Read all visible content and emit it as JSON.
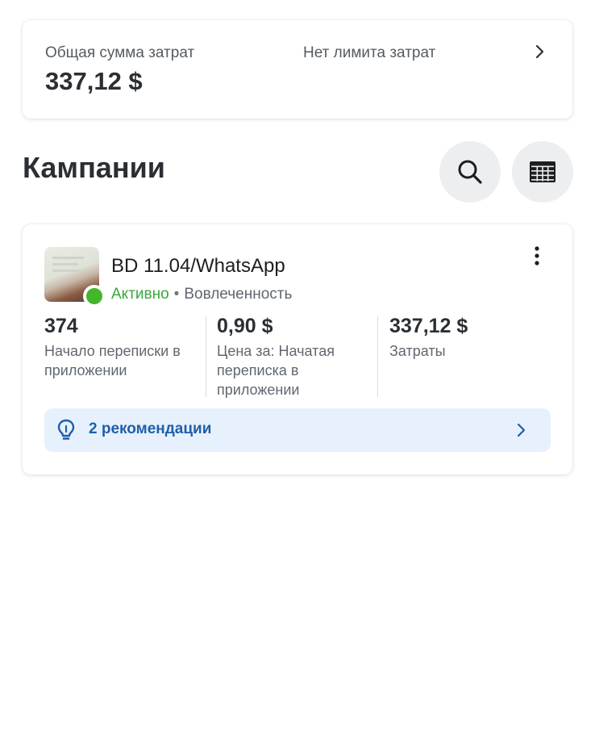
{
  "spend_summary": {
    "total_label": "Общая сумма затрат",
    "total_value": "337,12 $",
    "limit_label": "Нет лимита затрат",
    "chevron_icon": "chevron-right-icon"
  },
  "campaigns": {
    "title": "Кампании",
    "search_icon": "search-icon",
    "table_icon": "table-icon"
  },
  "campaign": {
    "name": "BD 11.04/WhatsApp",
    "status": "Активно",
    "status_color": "#42b72a",
    "separator": "•",
    "goal": "Вовлеченность",
    "more_icon": "more-vertical-icon",
    "metrics": [
      {
        "value": "374",
        "label": "Начало переписки в приложении"
      },
      {
        "value": "0,90 $",
        "label": "Цена за: Начатая переписка в приложении"
      },
      {
        "value": "337,12 $",
        "label": "Затраты"
      }
    ],
    "recommendations": {
      "label": "2 рекомендации",
      "icon": "lightbulb-icon",
      "accent_color": "#1f5fa8",
      "background": "#e7f1fd"
    }
  }
}
